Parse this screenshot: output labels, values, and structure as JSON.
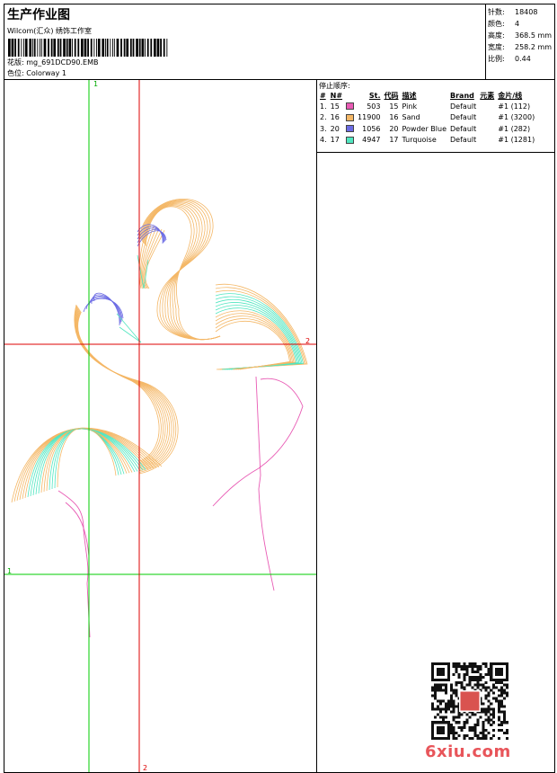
{
  "header": {
    "title": "生产作业图",
    "company": "Wilcom(汇众) 绣饰工作室",
    "design_label": "花版: ",
    "design_file": "mg_691DCD90.EMB",
    "colorway_label": "色位: ",
    "colorway": "Colorway 1"
  },
  "stats": [
    {
      "label": "针数:",
      "value": "18408"
    },
    {
      "label": "颜色:",
      "value": "4"
    },
    {
      "label": "高度:",
      "value": "368.5 mm"
    },
    {
      "label": "宽度:",
      "value": "258.2 mm"
    },
    {
      "label": "比例:",
      "value": "0.44"
    }
  ],
  "stop_sequence": {
    "title": "停止顺序:",
    "headers": [
      "#",
      "N#",
      "St.",
      "代码",
      "描述",
      "Brand",
      "元素",
      "金片/线"
    ],
    "rows": [
      {
        "index": "1.",
        "n": "15",
        "color": "#e85ab4",
        "stitches": "503",
        "code": "15",
        "desc": "Pink",
        "brand": "Default",
        "element": "",
        "sequin": "#1 (112)"
      },
      {
        "index": "2.",
        "n": "16",
        "color": "#f4b766",
        "stitches": "11900",
        "code": "16",
        "desc": "Sand",
        "brand": "Default",
        "element": "",
        "sequin": "#1 (3200)"
      },
      {
        "index": "3.",
        "n": "20",
        "color": "#6b6be4",
        "stitches": "1056",
        "code": "20",
        "desc": "Powder Blue",
        "brand": "Default",
        "element": "",
        "sequin": "#1 (282)"
      },
      {
        "index": "4.",
        "n": "17",
        "color": "#50e6c0",
        "stitches": "4947",
        "code": "17",
        "desc": "Turquoise",
        "brand": "Default",
        "element": "",
        "sequin": "#1 (1281)"
      }
    ]
  },
  "design_view": {
    "guide_labels": {
      "green_top": "1",
      "green_left": "1",
      "red_right": "2",
      "red_bottom": "2"
    },
    "colors": {
      "green_guide": "#00cc00",
      "red_guide": "#dd0000"
    }
  },
  "watermark": "6xiu.com"
}
